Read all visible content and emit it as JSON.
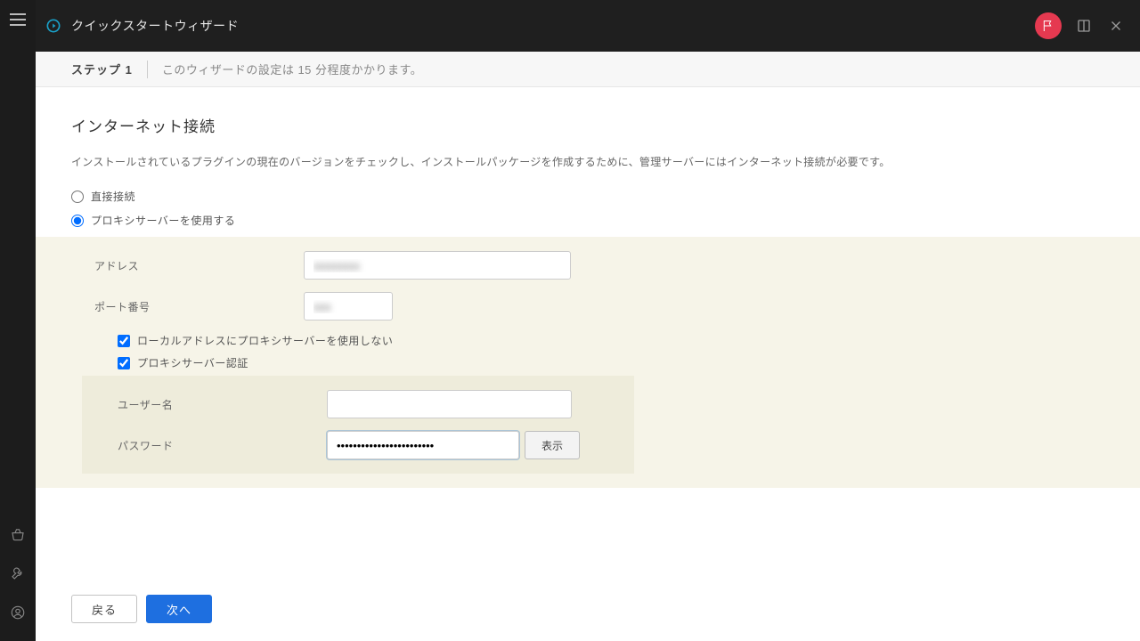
{
  "header": {
    "title": "クイックスタートウィザード"
  },
  "stepbar": {
    "step": "ステップ 1",
    "desc": "このウィザードの設定は 15 分程度かかります。"
  },
  "section": {
    "title": "インターネット接続",
    "desc": "インストールされているプラグインの現在のバージョンをチェックし、インストールパッケージを作成するために、管理サーバーにはインターネット接続が必要です。"
  },
  "radios": {
    "direct": "直接接続",
    "proxy": "プロキシサーバーを使用する"
  },
  "proxy": {
    "address_label": "アドレス",
    "address_value": "xxxxxxxx",
    "port_label": "ポート番号",
    "port_value": "xxx",
    "bypass_local_label": "ローカルアドレスにプロキシサーバーを使用しない",
    "auth_label": "プロキシサーバー認証",
    "username_label": "ユーザー名",
    "username_value": "",
    "password_label": "パスワード",
    "password_value": "••••••••••••••••••••••••",
    "show_btn": "表示"
  },
  "footer": {
    "back": "戻る",
    "next": "次へ"
  }
}
